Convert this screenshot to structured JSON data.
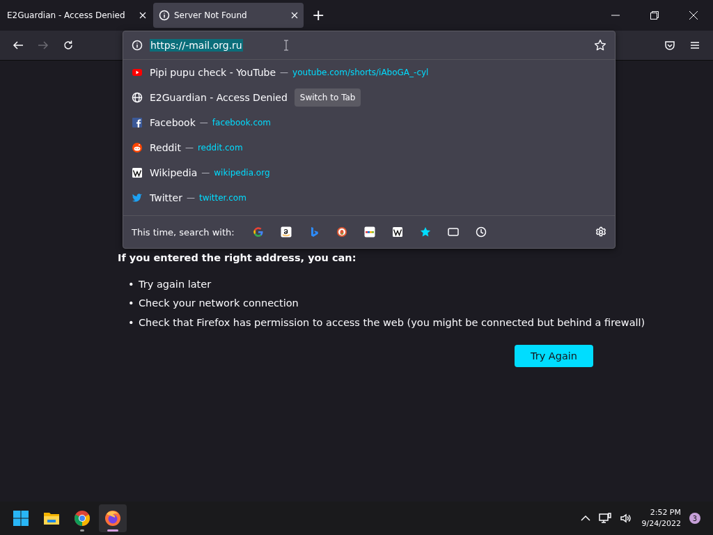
{
  "tabs": [
    {
      "title": "E2Guardian - Access Denied",
      "selected": false
    },
    {
      "title": "Server Not Found",
      "selected": true
    }
  ],
  "new_tab": "+",
  "address_bar": {
    "value": "https://-mail.org.ru"
  },
  "suggestions": [
    {
      "title": "Pipi pupu check - YouTube",
      "url": "youtube.com/shorts/iAboGA_-cyl"
    },
    {
      "title": "E2Guardian - Access Denied",
      "action": "Switch to Tab"
    },
    {
      "title": "Facebook",
      "url": "facebook.com"
    },
    {
      "title": "Reddit",
      "url": "reddit.com"
    },
    {
      "title": "Wikipedia",
      "url": "wikipedia.org"
    },
    {
      "title": "Twitter",
      "url": "twitter.com"
    }
  ],
  "separator": "—",
  "search_with": {
    "label": "This time, search with:"
  },
  "page": {
    "subheading": "If you entered the right address, you can:",
    "bullet": "•",
    "items": [
      "Try again later",
      "Check your network connection",
      "Check that Firefox has permission to access the web (you might be connected but behind a firewall)"
    ],
    "button": "Try Again"
  },
  "taskbar": {
    "apps": [
      {
        "selected": false,
        "running": false
      },
      {
        "selected": false,
        "running": false
      },
      {
        "selected": false,
        "running": true
      },
      {
        "selected": true,
        "running": true
      }
    ],
    "time": "2:52 PM",
    "date": "9/24/2022",
    "notifications": "3"
  }
}
